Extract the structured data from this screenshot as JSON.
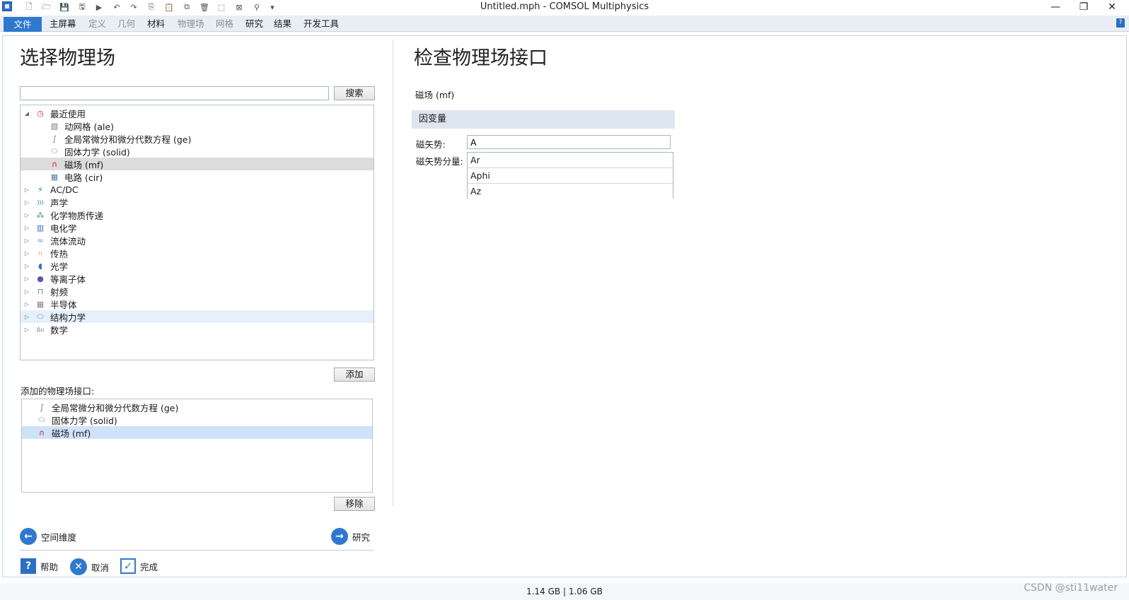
{
  "window": {
    "title": "Untitled.mph - COMSOL Multiphysics",
    "minimize_glyph": "—",
    "restore_glyph": "❐",
    "close_glyph": "✕"
  },
  "quick_access": [
    "new-icon",
    "open-icon",
    "save-icon",
    "save-as-icon",
    "run-icon",
    "undo-icon",
    "redo-icon",
    "copy-icon",
    "paste-icon",
    "duplicate-icon",
    "delete-icon",
    "select-icon",
    "deselect-icon",
    "zoom-icon",
    "dropdown-icon"
  ],
  "ribbon": {
    "tabs": [
      {
        "label": "文件",
        "state": "file"
      },
      {
        "label": "主屏幕",
        "state": "on"
      },
      {
        "label": "定义",
        "state": "dim"
      },
      {
        "label": "几何",
        "state": "dim"
      },
      {
        "label": "材料",
        "state": "on"
      },
      {
        "label": "物理场",
        "state": "dim"
      },
      {
        "label": "网格",
        "state": "dim"
      },
      {
        "label": "研究",
        "state": "on"
      },
      {
        "label": "结果",
        "state": "on"
      },
      {
        "label": "开发工具",
        "state": "on"
      }
    ],
    "help_glyph": "?"
  },
  "left": {
    "title": "选择物理场",
    "search_value": "",
    "search_button": "搜索",
    "tree": [
      {
        "label": "最近使用",
        "level": 0,
        "expanded": true,
        "icon": "clock-icon",
        "state": ""
      },
      {
        "label": "动网格 (ale)",
        "level": 1,
        "icon": "moving-mesh-icon",
        "state": ""
      },
      {
        "label": "全局常微分和微分代数方程 (ge)",
        "level": 1,
        "icon": "global-equation-icon",
        "state": ""
      },
      {
        "label": "固体力学 (solid)",
        "level": 1,
        "icon": "solid-mechanics-icon",
        "state": ""
      },
      {
        "label": "磁场 (mf)",
        "level": 1,
        "icon": "magnetic-field-icon",
        "state": "sel-grey"
      },
      {
        "label": "电路 (cir)",
        "level": 1,
        "icon": "circuit-icon",
        "state": ""
      },
      {
        "label": "AC/DC",
        "level": 0,
        "expanded": false,
        "icon": "acdc-icon",
        "state": ""
      },
      {
        "label": "声学",
        "level": 0,
        "expanded": false,
        "icon": "acoustics-icon",
        "state": ""
      },
      {
        "label": "化学物质传递",
        "level": 0,
        "expanded": false,
        "icon": "chemical-transport-icon",
        "state": ""
      },
      {
        "label": "电化学",
        "level": 0,
        "expanded": false,
        "icon": "electrochemistry-icon",
        "state": ""
      },
      {
        "label": "流体流动",
        "level": 0,
        "expanded": false,
        "icon": "fluid-flow-icon",
        "state": ""
      },
      {
        "label": "传热",
        "level": 0,
        "expanded": false,
        "icon": "heat-transfer-icon",
        "state": ""
      },
      {
        "label": "光学",
        "level": 0,
        "expanded": false,
        "icon": "optics-icon",
        "state": ""
      },
      {
        "label": "等离子体",
        "level": 0,
        "expanded": false,
        "icon": "plasma-icon",
        "state": ""
      },
      {
        "label": "射频",
        "level": 0,
        "expanded": false,
        "icon": "rf-icon",
        "state": ""
      },
      {
        "label": "半导体",
        "level": 0,
        "expanded": false,
        "icon": "semiconductor-icon",
        "state": ""
      },
      {
        "label": "结构力学",
        "level": 0,
        "expanded": false,
        "icon": "structural-mechanics-icon",
        "state": "hover"
      },
      {
        "label": "数学",
        "level": 0,
        "expanded": false,
        "icon": "math-icon",
        "state": ""
      }
    ],
    "add_button": "添加",
    "added_label": "添加的物理场接口:",
    "added": [
      {
        "label": "全局常微分和微分代数方程 (ge)",
        "icon": "global-equation-icon",
        "state": ""
      },
      {
        "label": "固体力学 (solid)",
        "icon": "solid-mechanics-icon",
        "state": ""
      },
      {
        "label": "磁场 (mf)",
        "icon": "magnetic-field-icon",
        "state": "sel-blue"
      }
    ],
    "remove_button": "移除",
    "back_button": "空间维度",
    "next_button": "研究",
    "help_button": "帮助",
    "cancel_button": "取消",
    "done_button": "完成"
  },
  "right": {
    "title": "检查物理场接口",
    "interface_name": "磁场 (mf)",
    "section_title": "因变量",
    "potential_label": "磁矢势:",
    "potential_value": "A",
    "components_label": "磁矢势分量:",
    "components": [
      "Ar",
      "Aphi",
      "Az"
    ]
  },
  "status": {
    "memory": "1.14 GB | 1.06 GB",
    "watermark": "CSDN @sti11water"
  },
  "colors": {
    "accent": "#2f78d0",
    "ribbon_bg": "#e9eef4",
    "section_bg": "#dde6f0",
    "selection_blue": "#cfe3f8",
    "selection_grey": "#dcdcdc"
  }
}
